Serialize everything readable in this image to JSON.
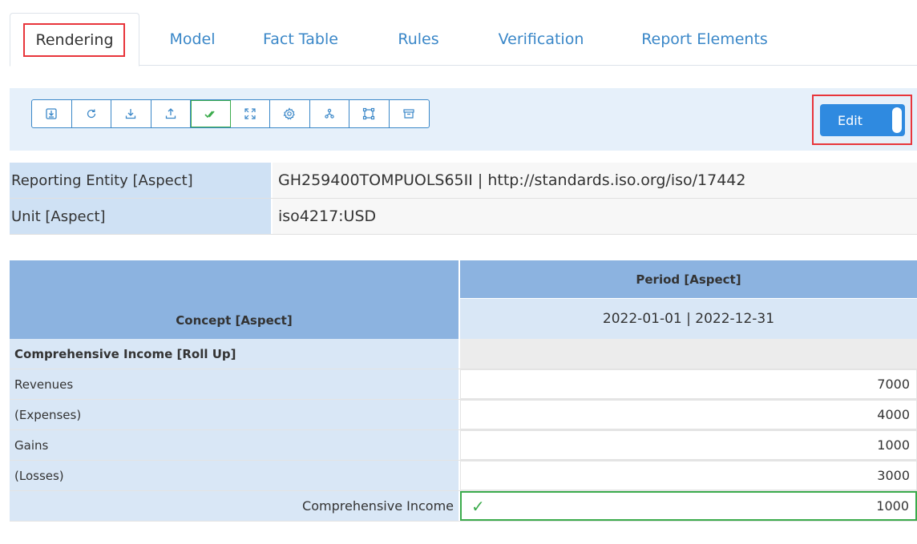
{
  "tabs": [
    {
      "label": "Rendering",
      "active": true
    },
    {
      "label": "Model"
    },
    {
      "label": "Fact Table"
    },
    {
      "label": "Rules"
    },
    {
      "label": "Verification"
    },
    {
      "label": "Report Elements"
    }
  ],
  "toolbar": {
    "buttons": [
      "import-icon",
      "refresh-icon",
      "download-icon",
      "upload-icon",
      "validate-icon",
      "expand-icon",
      "settings-icon",
      "hierarchy-icon",
      "frame-icon",
      "archive-icon"
    ],
    "edit_label": "Edit"
  },
  "aspects": {
    "entity_key": "Reporting Entity [Aspect]",
    "entity_value": "GH259400TOMPUOLS65II | http://standards.iso.org/iso/17442",
    "unit_key": "Unit [Aspect]",
    "unit_value": "iso4217:USD"
  },
  "grid": {
    "concept_header": "Concept [Aspect]",
    "period_header": "Period [Aspect]",
    "period_value": "2022-01-01 | 2022-12-31",
    "rollup_label": "Comprehensive Income [Roll Up]",
    "rows": [
      {
        "label": "Revenues",
        "value": "7000"
      },
      {
        "label": "(Expenses)",
        "value": "4000"
      },
      {
        "label": "Gains",
        "value": "1000"
      },
      {
        "label": "(Losses)",
        "value": "3000"
      }
    ],
    "total_label": "Comprehensive Income",
    "total_value": "1000"
  },
  "colors": {
    "accent": "#2f8ae0",
    "highlight": "#e8353b",
    "valid": "#3bab4c"
  }
}
